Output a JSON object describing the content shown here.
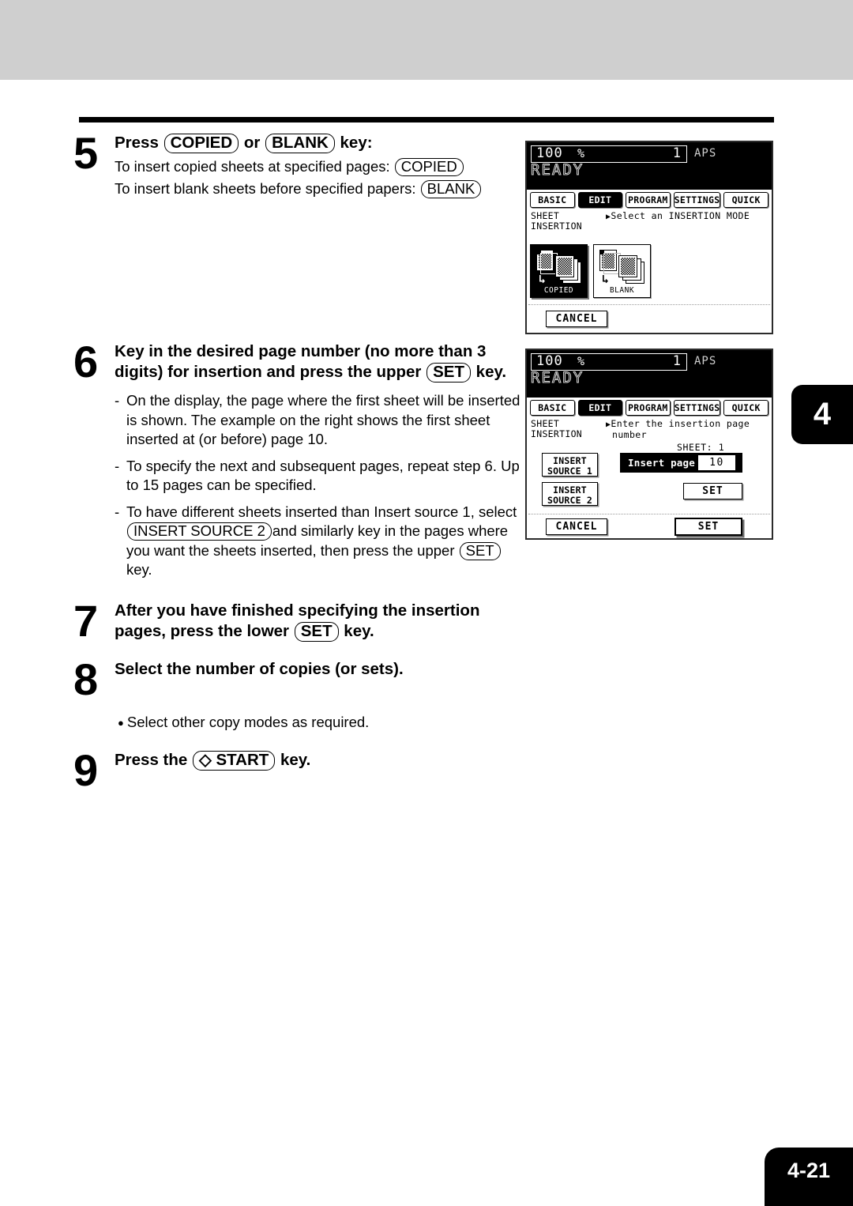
{
  "page": {
    "number": "4-21",
    "chapter_tab": "4"
  },
  "steps": [
    {
      "num": "5",
      "head_parts": [
        {
          "t": "text",
          "v": "Press "
        },
        {
          "t": "key",
          "v": "COPIED"
        },
        {
          "t": "text",
          "v": " or "
        },
        {
          "t": "key",
          "v": "BLANK"
        },
        {
          "t": "text",
          "v": " key:"
        }
      ],
      "lines": [
        {
          "text": "To insert copied sheets at specified pages: ",
          "key": "COPIED"
        },
        {
          "text": "To insert blank sheets before specified papers: ",
          "key": "BLANK"
        }
      ]
    },
    {
      "num": "6",
      "head_line1": "Key in the desired page number (no more than 3",
      "head_line2_a": "digits) for insertion and press the upper ",
      "head_line2_key": "SET",
      "head_line2_b": " key.",
      "bullets": [
        "On the display, the page where the first sheet will be inserted is shown. The example on the right shows the first sheet inserted at (or before) page 10.",
        "To specify the next and subsequent pages, repeat step 6. Up to 15 pages can be specified.",
        "To have different sheets inserted than Insert source 1, select INSERT SOURCE 2 and similarly key in the pages where you want the sheets inserted, then press the upper SET key."
      ],
      "bullet3_parts": [
        {
          "t": "text",
          "v": "To have different sheets inserted than Insert source 1, select "
        },
        {
          "t": "key",
          "v": "INSERT SOURCE 2"
        },
        {
          "t": "text",
          "v": "and similarly key in the pages where you want the sheets inserted, then press the upper "
        },
        {
          "t": "key",
          "v": "SET"
        },
        {
          "t": "text",
          "v": " key."
        }
      ]
    },
    {
      "num": "7",
      "head_line1": "After you have finished specifying the insertion",
      "head_line2_a": "pages, press the lower ",
      "head_line2_key": "SET",
      "head_line2_b": " key."
    },
    {
      "num": "8",
      "head_line1": "Select the number of copies (or sets).",
      "bullet": "Select other copy modes as required."
    },
    {
      "num": "9",
      "head_a": "Press the ",
      "head_key": "START",
      "head_key_icon": "start-diamond-icon",
      "head_b": " key."
    }
  ],
  "lcd_panels": [
    {
      "id": "panel-insertion-mode",
      "header": {
        "ratio": "100",
        "percent": "%",
        "copy_count": "1",
        "paper_mode": "APS",
        "status": "READY"
      },
      "tabs": [
        {
          "label": "BASIC",
          "selected": false
        },
        {
          "label": "EDIT",
          "selected": true
        },
        {
          "label": "PROGRAM",
          "selected": false
        },
        {
          "label": "SETTINGS",
          "selected": false
        },
        {
          "label": "QUICK",
          "selected": false
        }
      ],
      "mode_label_line1": "SHEET",
      "mode_label_line2": "INSERTION",
      "prompt": "Select an INSERTION MODE",
      "mode_buttons": [
        {
          "label": "COPIED",
          "selected": true
        },
        {
          "label": "BLANK",
          "selected": false
        }
      ],
      "cancel_label": "CANCEL"
    },
    {
      "id": "panel-insert-page",
      "header": {
        "ratio": "100",
        "percent": "%",
        "copy_count": "1",
        "paper_mode": "APS",
        "status": "READY"
      },
      "tabs": [
        {
          "label": "BASIC",
          "selected": false
        },
        {
          "label": "EDIT",
          "selected": true
        },
        {
          "label": "PROGRAM",
          "selected": false
        },
        {
          "label": "SETTINGS",
          "selected": false
        },
        {
          "label": "QUICK",
          "selected": false
        }
      ],
      "mode_label_line1": "SHEET",
      "mode_label_line2": "INSERTION",
      "prompt_line1": "Enter the insertion page",
      "prompt_line2": "number",
      "sheet_indicator_label": "SHEET:",
      "sheet_indicator_value": "1",
      "source_buttons": [
        {
          "line1": "INSERT",
          "line2": "SOURCE 1",
          "selected": false
        },
        {
          "line1": "INSERT",
          "line2": "SOURCE 2",
          "selected": false
        }
      ],
      "insert_page": {
        "label": "Insert page",
        "colon": ":",
        "value": "10"
      },
      "upper_set_label": "SET",
      "cancel_label": "CANCEL",
      "lower_set_label": "SET"
    }
  ]
}
